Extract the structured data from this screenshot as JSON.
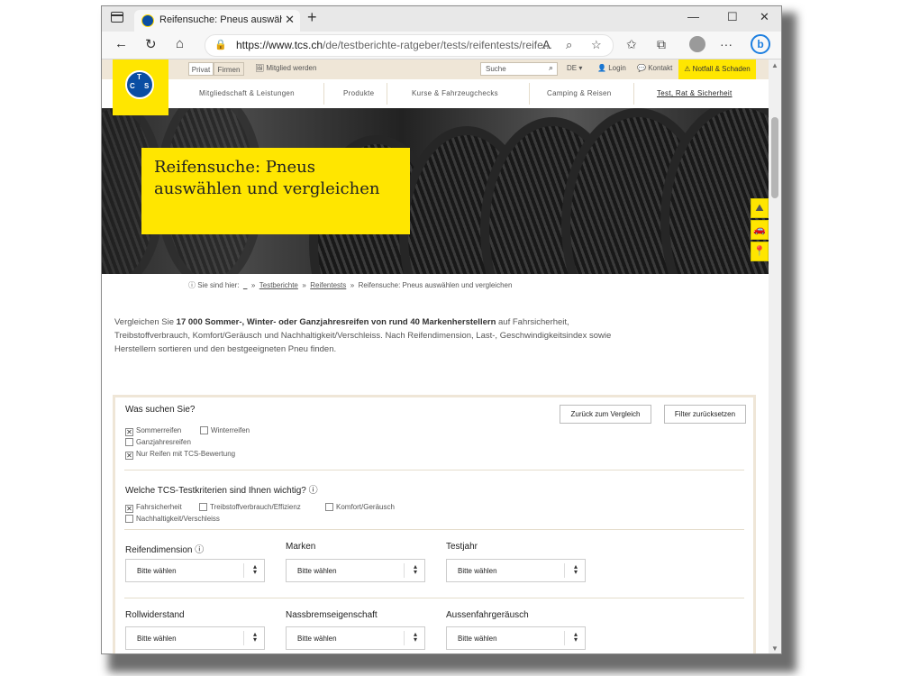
{
  "browser": {
    "tab_title": "Reifensuche: Pneus auswählen u",
    "url_main": "https://www.tcs.ch",
    "url_rest": "/de/testberichte-ratgeber/tests/reifentests/reife..."
  },
  "topbar": {
    "private_label": "Privat",
    "business_label": "Firmen",
    "member_label": "Mitglied werden",
    "search_placeholder": "Suche",
    "lang_label": "DE ▾",
    "login_label": "Login",
    "contact_label": "Kontakt",
    "emergency_label": "Notfall & Schaden"
  },
  "logo": {
    "letters": [
      "T",
      "C",
      "S"
    ]
  },
  "mainnav": [
    "Mitgliedschaft & Leistungen",
    "Produkte",
    "Kurse & Fahrzeugchecks",
    "Camping & Reisen",
    "Test, Rat & Sicherheit"
  ],
  "hero": {
    "title": "Reifensuche: Pneus auswählen und vergleichen"
  },
  "breadcrumb": {
    "prefix": "Sie sind hier:",
    "home": "_",
    "items": [
      "Testberichte",
      "Reifentests"
    ],
    "current": "Reifensuche: Pneus auswählen und vergleichen",
    "separator": "»"
  },
  "intro": {
    "p1": "Vergleichen Sie ",
    "bold": "17 000 Sommer-, Winter- oder Ganzjahresreifen von rund 40 Markenherstellern",
    "p2": " auf Fahrsicherheit, Treibstoffverbrauch, Komfort/Geräusch und Nachhaltigkeit/Verschleiss. Nach Reifendimension, Last-, Geschwindigkeitsindex sowie Herstellern sortieren und den bestgeeigneten Pneu finden."
  },
  "filter": {
    "question1": "Was suchen Sie?",
    "back_button": "Zurück zum Vergleich",
    "reset_button": "Filter zurücksetzen",
    "tire_types": [
      {
        "label": "Sommerreifen",
        "checked": true
      },
      {
        "label": "Winterreifen",
        "checked": false
      },
      {
        "label": "Ganzjahresreifen",
        "checked": false
      },
      {
        "label": "Nur Reifen mit TCS-Bewertung",
        "checked": true
      }
    ],
    "question2": "Welche TCS-Testkriterien sind Ihnen wichtig?",
    "criteria": [
      {
        "label": "Fahrsicherheit",
        "checked": true
      },
      {
        "label": "Treibstoffverbrauch/Effizienz",
        "checked": false
      },
      {
        "label": "Komfort/Geräusch",
        "checked": false
      },
      {
        "label": "Nachhaltigkeit/Verschleiss",
        "checked": false
      }
    ],
    "selects_row1": [
      {
        "label": "Reifendimension",
        "info": true,
        "value": "Bitte wählen"
      },
      {
        "label": "Marken",
        "info": false,
        "value": "Bitte wählen"
      },
      {
        "label": "Testjahr",
        "info": false,
        "value": "Bitte wählen"
      }
    ],
    "selects_row2": [
      {
        "label": "Rollwiderstand",
        "info": false,
        "value": "Bitte wählen"
      },
      {
        "label": "Nassbremseigenschaft",
        "info": false,
        "value": "Bitte wählen"
      },
      {
        "label": "Aussenfahrgeräusch",
        "info": false,
        "value": "Bitte wählen"
      }
    ]
  },
  "colors": {
    "brand_yellow": "#ffe600",
    "brand_blue": "#0a4ea3",
    "topbar_beige": "#efe6d7"
  }
}
